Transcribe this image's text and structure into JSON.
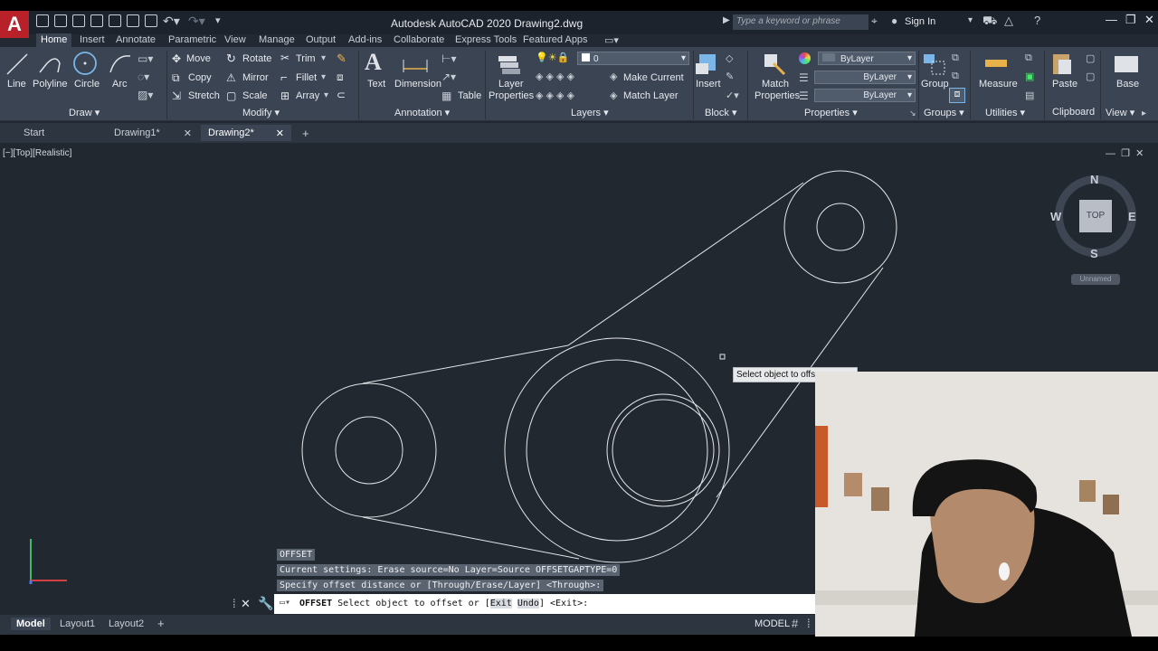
{
  "app": {
    "title": "Autodesk AutoCAD 2020   Drawing2.dwg",
    "logo": "A"
  },
  "search": {
    "placeholder": "Type a keyword or phrase"
  },
  "account": {
    "signin": "Sign In"
  },
  "menu_tabs": [
    "Home",
    "Insert",
    "Annotate",
    "Parametric",
    "View",
    "Manage",
    "Output",
    "Add-ins",
    "Collaborate",
    "Express Tools",
    "Featured Apps"
  ],
  "ribbon": {
    "draw": {
      "line": "Line",
      "polyline": "Polyline",
      "circle": "Circle",
      "arc": "Arc",
      "panel": "Draw"
    },
    "modify": {
      "move": "Move",
      "rotate": "Rotate",
      "trim": "Trim",
      "copy": "Copy",
      "mirror": "Mirror",
      "fillet": "Fillet",
      "stretch": "Stretch",
      "scale": "Scale",
      "array": "Array",
      "panel": "Modify"
    },
    "annotation": {
      "text": "Text",
      "dimension": "Dimension",
      "table": "Table",
      "panel": "Annotation"
    },
    "layers": {
      "layer_properties_1": "Layer",
      "layer_properties_2": "Properties",
      "current_layer": "0",
      "make_current": "Make Current",
      "match_layer": "Match Layer",
      "panel": "Layers"
    },
    "block": {
      "insert": "Insert",
      "panel": "Block"
    },
    "properties": {
      "match_1": "Match",
      "match_2": "Properties",
      "color": "ByLayer",
      "linetype": "ByLayer",
      "lineweight": "ByLayer",
      "panel": "Properties"
    },
    "groups": {
      "group": "Group",
      "panel": "Groups"
    },
    "utilities": {
      "measure": "Measure",
      "panel": "Utilities"
    },
    "clipboard": {
      "paste": "Paste",
      "panel": "Clipboard"
    },
    "view": {
      "base": "Base",
      "panel": "View"
    }
  },
  "doc_tabs": [
    "Start",
    "Drawing1*",
    "Drawing2*"
  ],
  "viewport": {
    "label": "[−][Top][Realistic]"
  },
  "viewcube": {
    "n": "N",
    "s": "S",
    "e": "E",
    "w": "W",
    "top": "TOP",
    "ucs": "Unnamed"
  },
  "tooltip": "Select object to offs",
  "command": {
    "history": [
      "OFFSET",
      "Current settings: Erase source=No  Layer=Source  OFFSETGAPTYPE=0",
      "Specify offset distance or [Through/Erase/Layer] <Through>:"
    ],
    "name": "OFFSET",
    "prompt_pre": "Select object to offset or [",
    "opt_exit": "Exit",
    "opt_undo": "Undo",
    "prompt_post": "] <Exit>:"
  },
  "status": {
    "tabs": [
      "Model",
      "Layout1",
      "Layout2"
    ],
    "space": "MODEL"
  }
}
